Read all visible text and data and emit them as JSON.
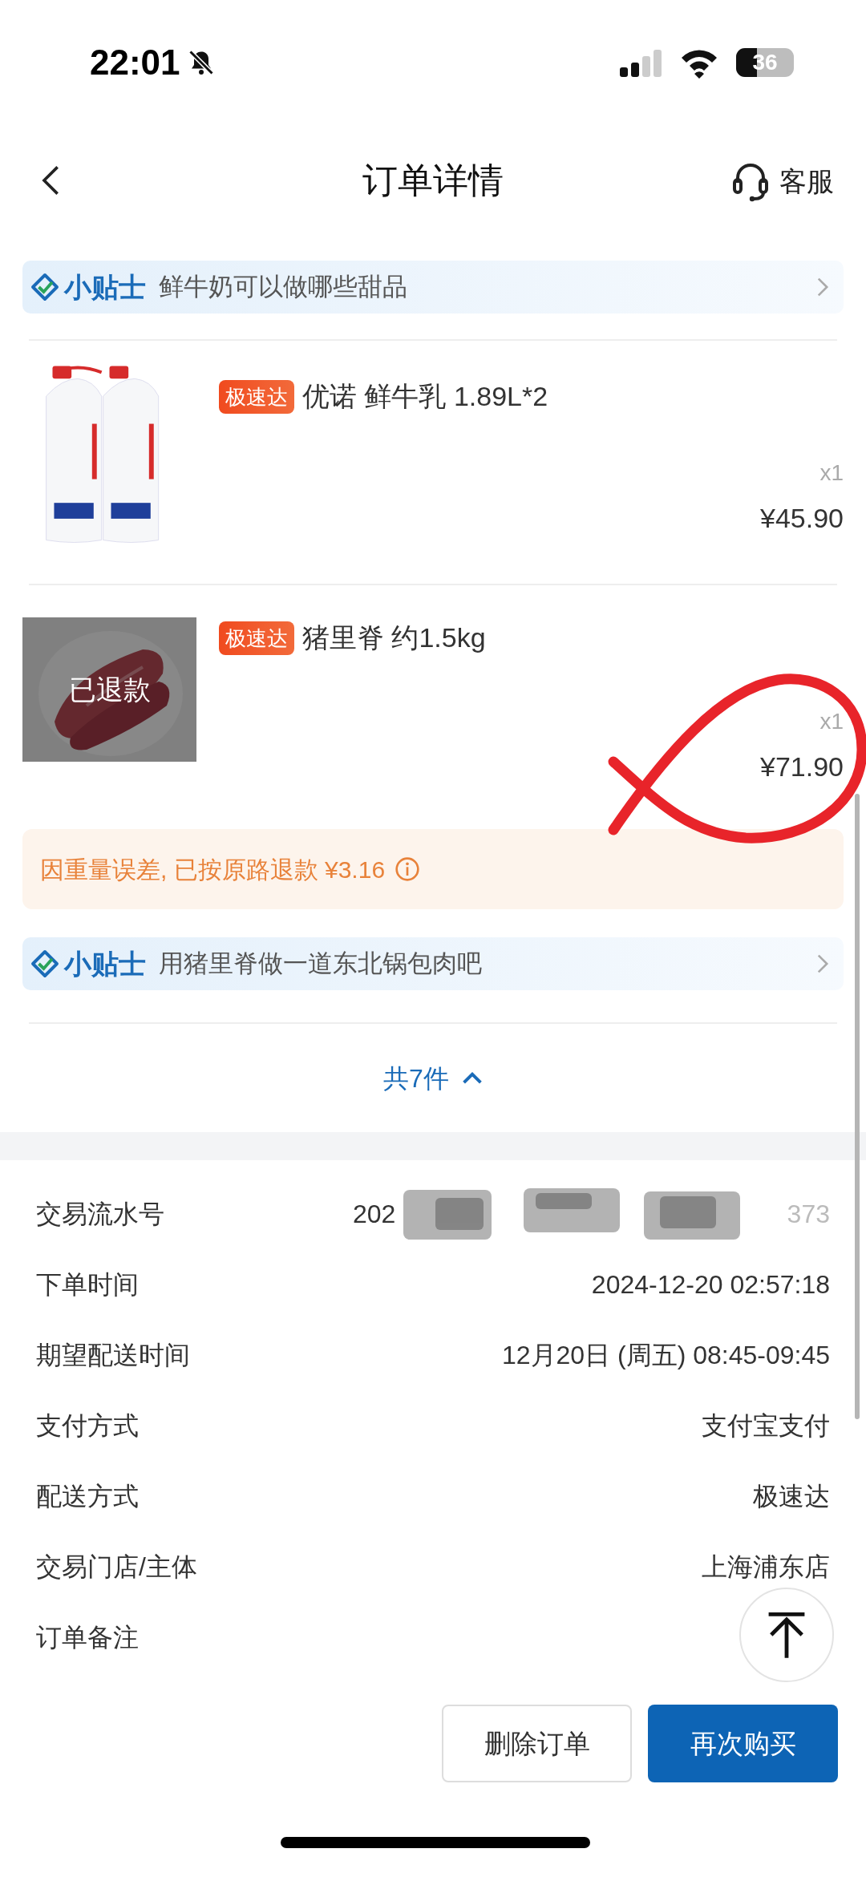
{
  "status_bar": {
    "time": "22:01",
    "battery": "36",
    "silent": true
  },
  "nav": {
    "title": "订单详情",
    "service": "客服"
  },
  "items": [
    {
      "kind": "tip",
      "badge": "小贴士",
      "text": "鲜牛奶可以做哪些甜品"
    },
    {
      "kind": "product",
      "tag": "极速达",
      "name": "优诺 鲜牛乳 1.89L*2",
      "qty": "x1",
      "price": "¥45.90",
      "refunded": false
    },
    {
      "kind": "product",
      "tag": "极速达",
      "name": "猪里脊 约1.5kg",
      "qty": "x1",
      "price": "¥71.90",
      "refunded": true,
      "refund_label": "已退款"
    },
    {
      "kind": "notice",
      "text": "因重量误差, 已按原路退款 ¥3.16"
    },
    {
      "kind": "tip",
      "badge": "小贴士",
      "text": "用猪里脊做一道东北锅包肉吧"
    }
  ],
  "total": {
    "label": "共7件",
    "expanded": true
  },
  "details": [
    {
      "label": "交易流水号",
      "value": "202",
      "value_end": "373"
    },
    {
      "label": "下单时间",
      "value": "2024-12-20 02:57:18"
    },
    {
      "label": "期望配送时间",
      "value": "12月20日 (周五) 08:45-09:45"
    },
    {
      "label": "支付方式",
      "value": "支付宝支付"
    },
    {
      "label": "配送方式",
      "value": "极速达"
    },
    {
      "label": "交易门店/主体",
      "value": "上海浦东店"
    },
    {
      "label": "订单备注"
    }
  ],
  "actions": [
    {
      "label": "删除订单",
      "primary": false
    },
    {
      "label": "再次购买",
      "primary": true
    }
  ]
}
